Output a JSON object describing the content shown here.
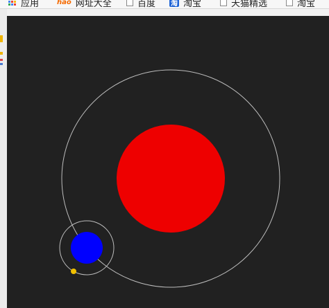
{
  "bookmarks": {
    "items": [
      {
        "label": "应用",
        "icon": "apps-grid-icon"
      },
      {
        "label": "网址大全",
        "icon": "hao123-icon"
      },
      {
        "label": "百度",
        "icon": "page-icon"
      },
      {
        "label": "淘宝",
        "icon": "taobao-icon"
      },
      {
        "label": "天猫精选",
        "icon": "page-icon"
      },
      {
        "label": "淘宝",
        "icon": "page-icon"
      }
    ]
  },
  "taobao_icon_glyph": "淘",
  "scene": {
    "background_color": "#212121",
    "orbit_color": "#bdbdbd",
    "sun": {
      "color": "#ee0000"
    },
    "planet": {
      "color": "#0000ff"
    },
    "moon": {
      "color": "#f0c000"
    }
  }
}
